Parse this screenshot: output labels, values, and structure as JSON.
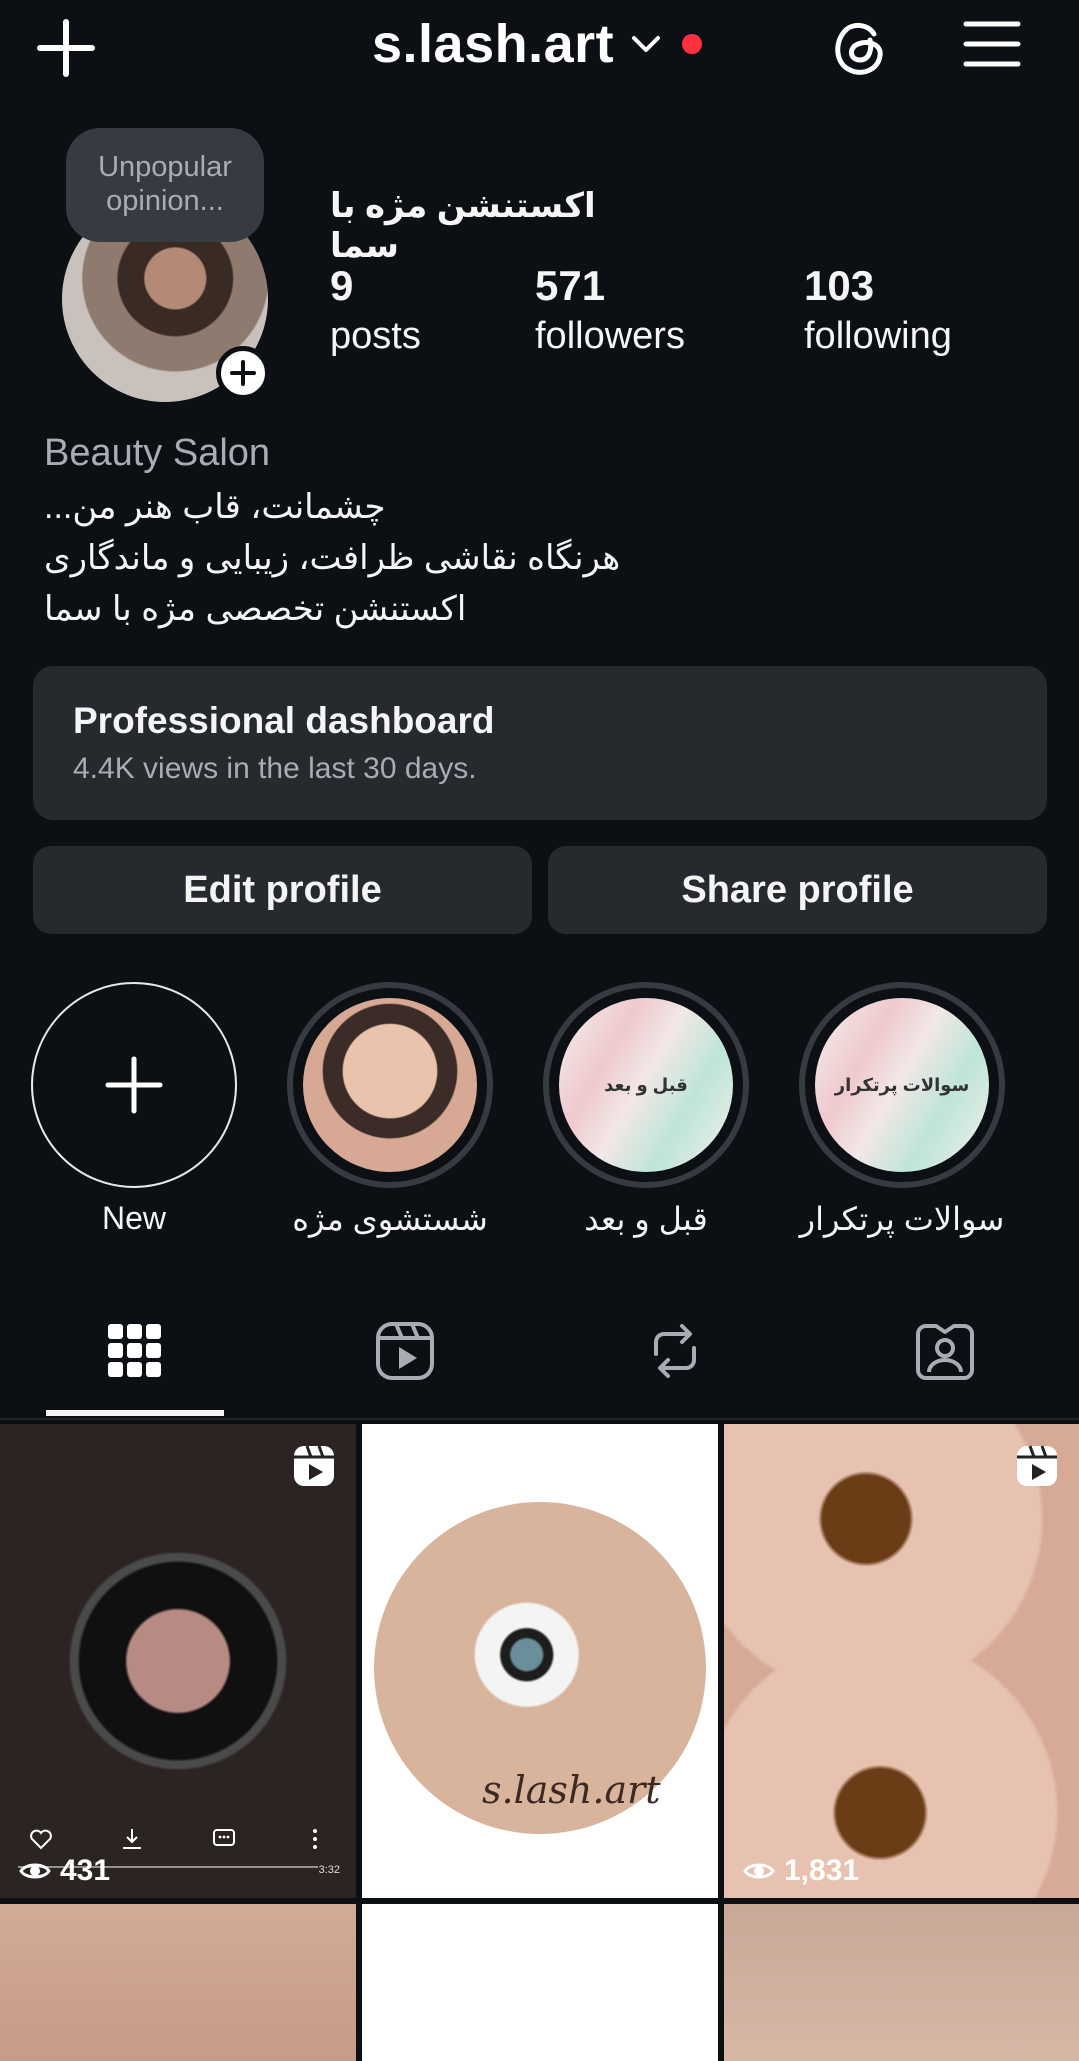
{
  "header": {
    "username": "s.lash.art",
    "icons": [
      "plus-icon",
      "chevron-down-icon",
      "threads-icon",
      "menu-icon"
    ],
    "notification_dot_color": "#ff3040"
  },
  "profile": {
    "note": "Unpopular opinion...",
    "full_name": "اکستنشن مژه با سما",
    "stats": {
      "posts": {
        "value": "9",
        "label": "posts"
      },
      "followers": {
        "value": "571",
        "label": "followers"
      },
      "following": {
        "value": "103",
        "label": "following"
      }
    },
    "category": "Beauty Salon",
    "bio_lines": [
      "چشمانت، قاب هنر من...",
      "هرنگاه نقاشی ظرافت، زیبایی و ماندگاری",
      "اکستنشن تخصصی مژه با سما"
    ]
  },
  "dashboard": {
    "title": "Professional dashboard",
    "subtitle": "4.4K views in the last 30 days."
  },
  "buttons": {
    "edit": "Edit profile",
    "share": "Share profile"
  },
  "highlights": [
    {
      "label": "New",
      "cover_text": ""
    },
    {
      "label": "شستشوی مژه",
      "cover_text": ""
    },
    {
      "label": "قبل و بعد",
      "cover_text": "قبل و بعد"
    },
    {
      "label": "سوالات پرتکرار",
      "cover_text": "سوالات پرتکرار"
    }
  ],
  "tabs": [
    "grid-icon",
    "reels-icon",
    "reposts-icon",
    "tagged-icon"
  ],
  "grid": {
    "posts": [
      {
        "type": "reel",
        "views": "431",
        "duration": "3:32"
      },
      {
        "type": "image",
        "overlay_text": "s.lash.art"
      },
      {
        "type": "reel",
        "views": "1,831"
      },
      {
        "type": "image"
      },
      {
        "type": "image"
      },
      {
        "type": "image"
      }
    ]
  }
}
